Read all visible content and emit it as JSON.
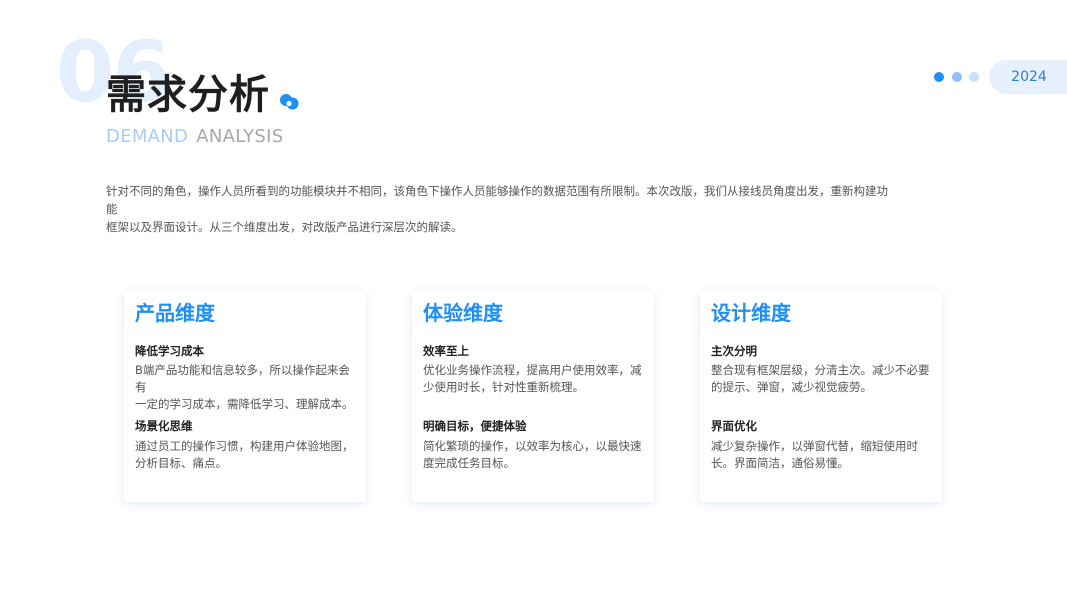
{
  "header": {
    "number": "06",
    "title": "需求分析",
    "subtitle_word1": "DEMAND",
    "subtitle_word2": "ANALYSIS",
    "year": "2024"
  },
  "colors": {
    "accent": "#1e8ff5",
    "dot_1": "#1e8ff5",
    "dot_2": "#8ec1f5",
    "dot_3": "#c9e0fa",
    "pill_bg": "#e6f1fd"
  },
  "intro": {
    "line1": "针对不同的角色，操作人员所看到的功能模块并不相同，该角色下操作人员能够操作的数据范围有所限制。本次改版，我们从接线员角度出发，重新构建功能",
    "line2": "框架以及界面设计。从三个维度出发，对改版产品进行深层次的解读。"
  },
  "cards": [
    {
      "title": "产品维度",
      "sections": [
        {
          "heading": "降低学习成本",
          "lines": [
            "B端产品功能和信息较多，所以操作起来会有",
            "一定的学习成本，需降低学习、理解成本。"
          ]
        },
        {
          "heading": "场景化思维",
          "lines": [
            "通过员工的操作习惯，构建用户体验地图，",
            "分析目标、痛点。"
          ]
        }
      ]
    },
    {
      "title": "体验维度",
      "sections": [
        {
          "heading": "效率至上",
          "lines": [
            "优化业务操作流程，提高用户使用效率，减",
            "少使用时长，针对性重新梳理。"
          ]
        },
        {
          "heading": "明确目标，便捷体验",
          "lines": [
            "简化繁琐的操作，以效率为核心，以最快速",
            "度完成任务目标。"
          ]
        }
      ]
    },
    {
      "title": "设计维度",
      "sections": [
        {
          "heading": "主次分明",
          "lines": [
            "整合现有框架层级，分清主次。减少不必要",
            "的提示、弹窗，减少视觉疲劳。"
          ]
        },
        {
          "heading": "界面优化",
          "lines": [
            "减少复杂操作，以弹窗代替，缩短使用时",
            "长。界面简洁，通俗易懂。"
          ]
        }
      ]
    }
  ]
}
